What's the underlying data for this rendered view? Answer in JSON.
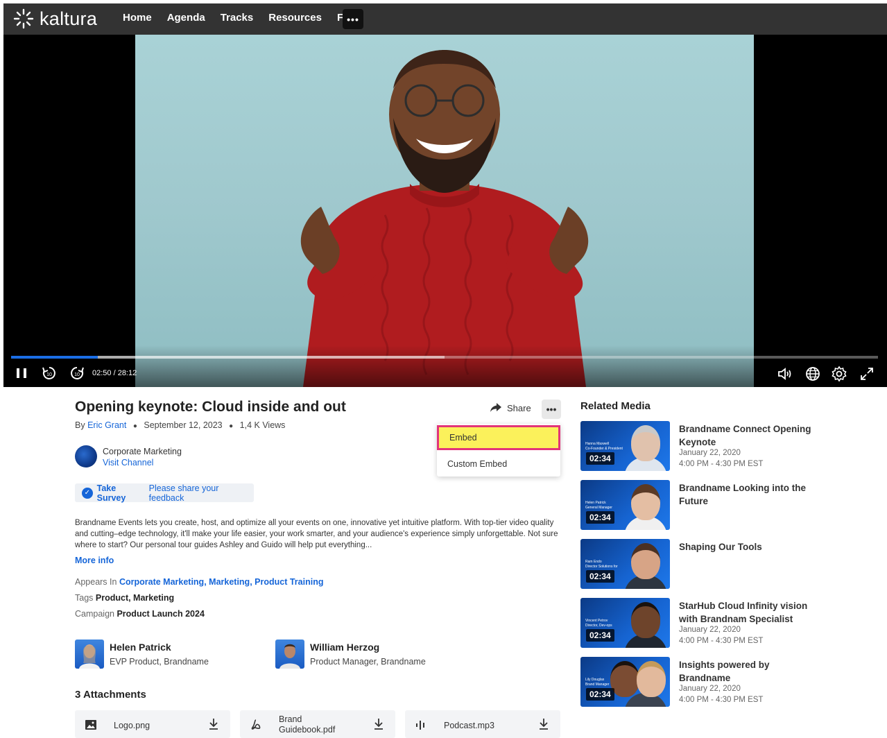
{
  "brand": {
    "logo_text": "kaltura"
  },
  "nav": {
    "items": [
      "Home",
      "Agenda",
      "Tracks",
      "Resources",
      "Faq"
    ],
    "more_label": "•••"
  },
  "player": {
    "time": "02:50 / 28:12",
    "progress": 0.1,
    "buffered": 0.5
  },
  "entry": {
    "title": "Opening keynote: Cloud inside and out",
    "by_label": "By",
    "author": "Eric Grant",
    "date": "September 12, 2023",
    "views": "1,4 K Views",
    "share_label": "Share",
    "more_label": "•••"
  },
  "dropdown": {
    "items": [
      "Embed",
      "Custom Embed"
    ]
  },
  "channel": {
    "name": "Corporate Marketing",
    "link": "Visit Channel"
  },
  "survey": {
    "take": "Take Survey",
    "message": "Please share your feedback"
  },
  "description": "Brandname Events lets you create, host, and optimize all your events on one, innovative yet intuitive platform. With top-tier video quality and cutting–edge technology, it'll make your life easier, your work smarter, and your audience's experience simply unforgettable. Not sure where to start? Our personal tour guides Ashley and Guido will help put everything...",
  "more_info": "More info",
  "appears_in": {
    "label": "Appears In",
    "items": [
      "Corporate Marketing",
      "Marketing",
      "Product Training"
    ]
  },
  "tags": {
    "label": "Tags",
    "value": "Product, Marketing"
  },
  "campaign": {
    "label": "Campaign",
    "value": "Product Launch 2024"
  },
  "people": [
    {
      "name": "Helen Patrick",
      "role": "EVP Product, Brandname"
    },
    {
      "name": "William Herzog",
      "role": "Product Manager, Brandname"
    }
  ],
  "attachments": {
    "title": "3 Attachments",
    "items": [
      {
        "name": "Logo.png",
        "icon": "image-icon"
      },
      {
        "name": "Brand Guidebook.pdf",
        "icon": "pdf-icon"
      },
      {
        "name": "Podcast.mp3",
        "icon": "audio-icon"
      }
    ]
  },
  "related": {
    "title": "Related Media",
    "items": [
      {
        "title": "Brandname Connect Opening Keynote",
        "date": "January 22, 2020",
        "time": "4:00 PM - 4:30 PM EST",
        "duration": "02:34",
        "caption1": "Hanna Maxwell",
        "caption2": "Co-Founder & President"
      },
      {
        "title": "Brandname Looking into the Future",
        "date": "",
        "time": "",
        "duration": "02:34",
        "caption1": "Helen Patrick",
        "caption2": "General Manager"
      },
      {
        "title": "Shaping Our Tools",
        "date": "",
        "time": "",
        "duration": "02:34",
        "caption1": "Ram Endo",
        "caption2": "Director Solutions for"
      },
      {
        "title": "StarHub Cloud Infinity vision with Brandnam Specialist",
        "date": "January 22, 2020",
        "time": "4:00 PM - 4:30 PM EST",
        "duration": "02:34",
        "caption1": "Vincent Petrov",
        "caption2": "Director, Dev-ops"
      },
      {
        "title": "Insights powered by Brandname",
        "date": "January 22, 2020",
        "time": "4:00 PM - 4:30 PM EST",
        "duration": "02:34",
        "caption1": "Lily Douglas",
        "caption2": "Brand Manager"
      }
    ]
  },
  "colors": {
    "accent": "#1565d8",
    "highlight": "#fbf15b",
    "highlight_border": "#e2347a",
    "topbar": "#333333"
  }
}
